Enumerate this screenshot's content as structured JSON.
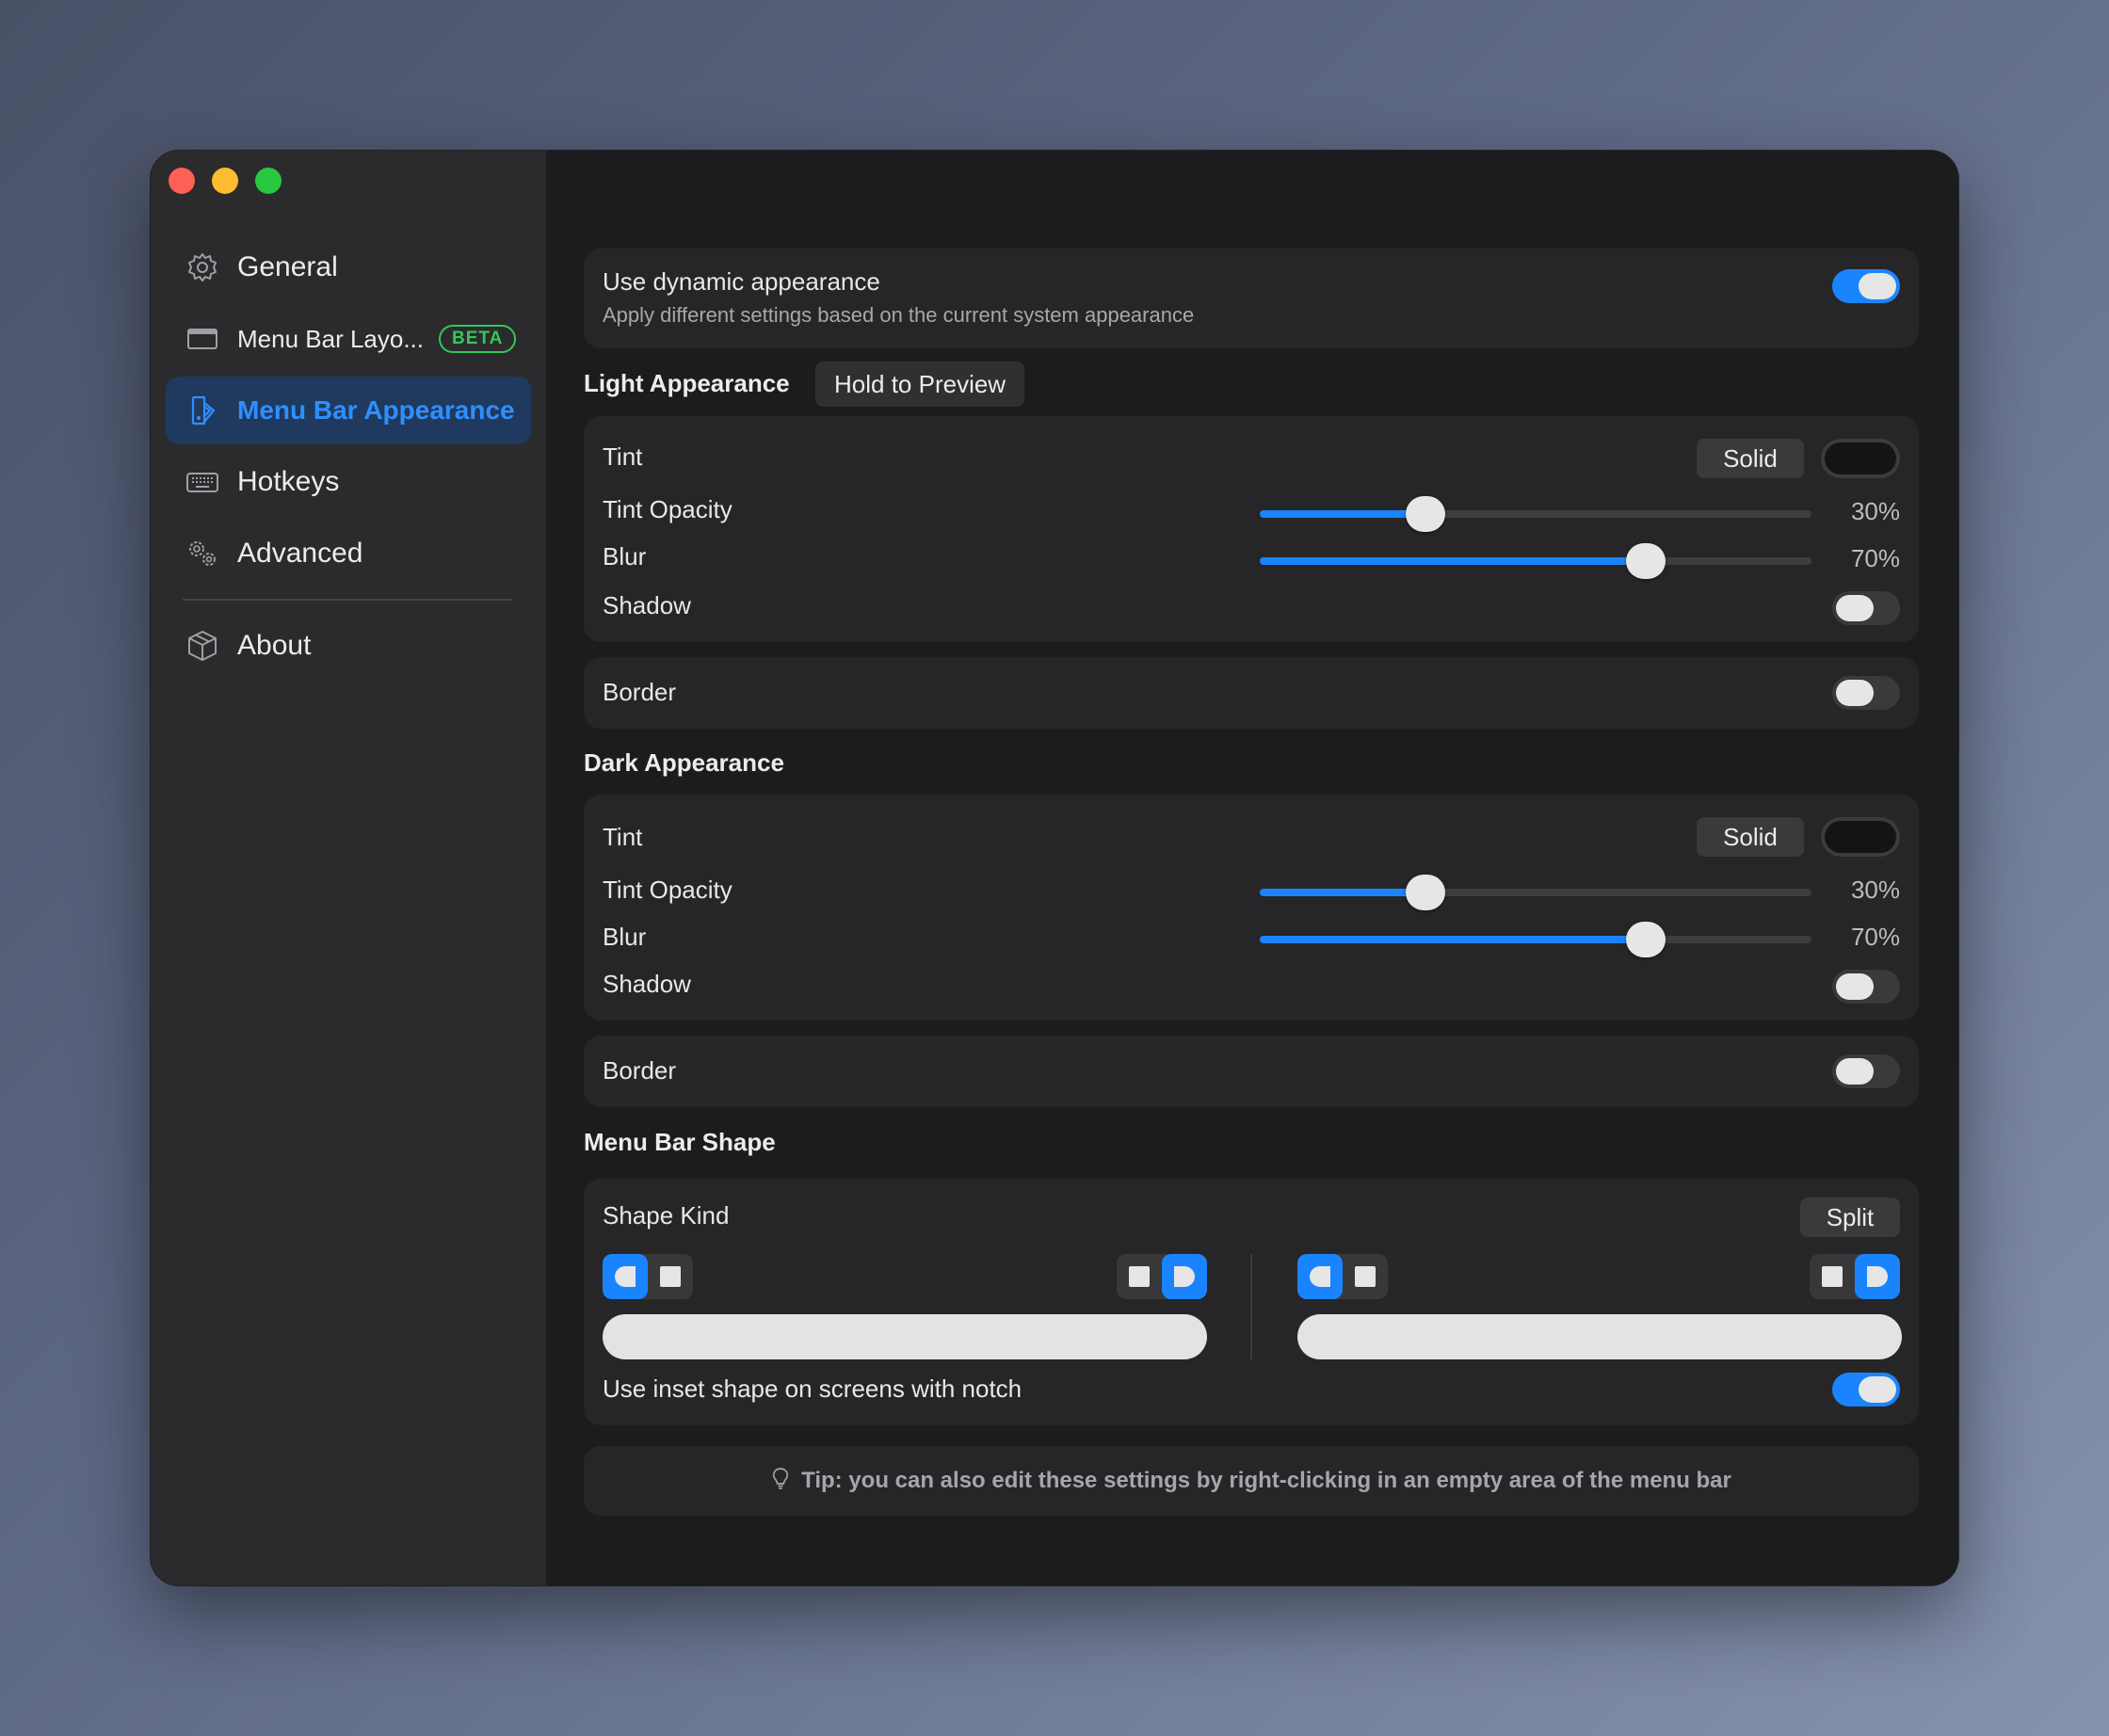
{
  "sidebar": {
    "items": [
      {
        "label": "General",
        "icon": "gear-icon"
      },
      {
        "label": "Menu Bar Layo...",
        "icon": "menu-bar-layout-icon",
        "badge": "BETA"
      },
      {
        "label": "Menu Bar Appearance",
        "icon": "paintbrush-icon",
        "active": true
      },
      {
        "label": "Hotkeys",
        "icon": "keyboard-icon"
      },
      {
        "label": "Advanced",
        "icon": "gears-icon"
      },
      {
        "label": "About",
        "icon": "package-icon"
      }
    ]
  },
  "dynamic": {
    "label": "Use dynamic appearance",
    "description": "Apply different settings based on the current system appearance",
    "enabled": true
  },
  "light": {
    "title": "Light Appearance",
    "preview_button": "Hold to Preview",
    "tint_label": "Tint",
    "tint_mode": "Solid",
    "tint_color": "#141416",
    "opacity_label": "Tint Opacity",
    "opacity_value": 0.3,
    "opacity_text": "30%",
    "blur_label": "Blur",
    "blur_value": 0.7,
    "blur_text": "70%",
    "shadow_label": "Shadow",
    "shadow_enabled": false,
    "border_label": "Border",
    "border_enabled": false
  },
  "dark": {
    "title": "Dark Appearance",
    "tint_label": "Tint",
    "tint_mode": "Solid",
    "tint_color": "#141416",
    "opacity_label": "Tint Opacity",
    "opacity_value": 0.3,
    "opacity_text": "30%",
    "blur_label": "Blur",
    "blur_value": 0.7,
    "blur_text": "70%",
    "shadow_label": "Shadow",
    "shadow_enabled": false,
    "border_label": "Border",
    "border_enabled": false
  },
  "shape": {
    "title": "Menu Bar Shape",
    "kind_label": "Shape Kind",
    "kind_value": "Split",
    "notch_label": "Use inset shape on screens with notch",
    "notch_enabled": true
  },
  "tip": {
    "icon": "lightbulb-icon",
    "text": "Tip: you can also edit these settings by right-clicking in an empty area of the menu bar"
  },
  "colors": {
    "accent": "#1a84ff",
    "sidebar_active": "#1f3a5e",
    "beta_badge": "#34c759"
  }
}
